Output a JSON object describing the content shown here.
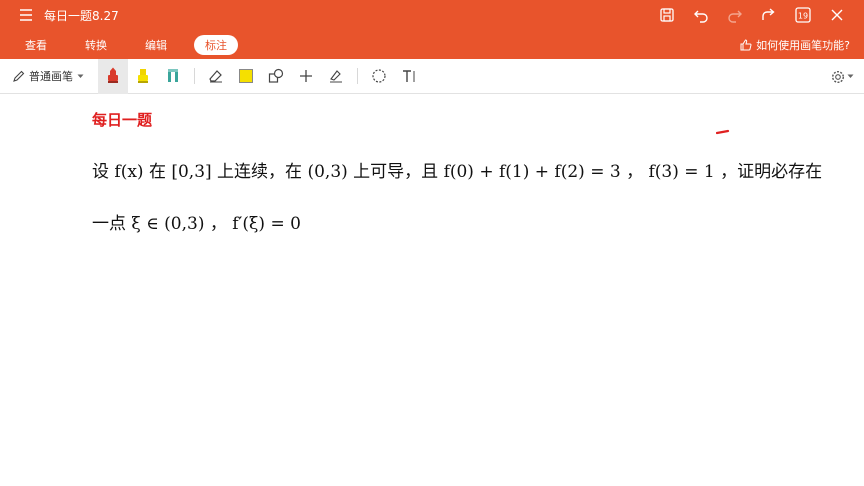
{
  "app": {
    "doc_title": "每日一题8.27",
    "accent": "#e8542c"
  },
  "title_actions": [
    {
      "name": "save-icon"
    },
    {
      "name": "undo-icon"
    },
    {
      "name": "redo-icon"
    },
    {
      "name": "share-icon"
    },
    {
      "name": "page-count-icon",
      "label": "19"
    },
    {
      "name": "close-icon"
    }
  ],
  "tabs": [
    {
      "label": "查看",
      "active": false
    },
    {
      "label": "转换",
      "active": false
    },
    {
      "label": "编辑",
      "active": false
    },
    {
      "label": "标注",
      "active": true
    }
  ],
  "help_text": "如何使用画笔功能?",
  "toolbar": {
    "pen_type": "普通画笔",
    "tools": [
      "pen-red-icon",
      "highlighter-yellow-icon",
      "highlighter-teal-icon",
      "eraser-icon",
      "color-swatch-icon",
      "shapes-icon",
      "add-icon",
      "signature-icon",
      "lasso-icon",
      "text-tool-icon"
    ],
    "swatch_color": "#f5e000",
    "pen_color": "#d93a2b"
  },
  "document": {
    "heading": "每日一题",
    "line1": "设 f(x) 在 [0,3] 上连续，在 (0,3) 上可导，且 f(0) + f(1) + f(2) = 3 ， f(3) = 1 ，证明必存在",
    "line2": "一点 ξ ∈ (0,3) ， f′(ξ) = 0"
  }
}
